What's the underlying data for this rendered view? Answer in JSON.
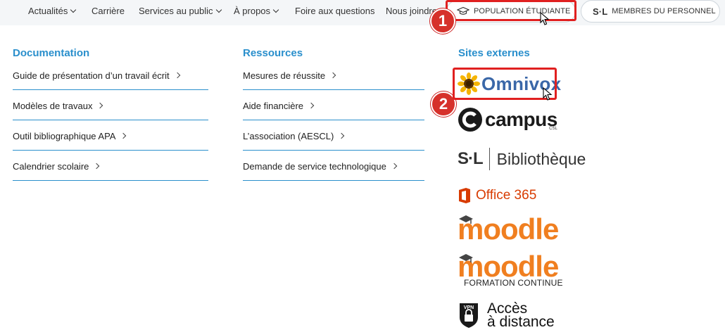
{
  "nav": {
    "items": [
      {
        "label": "Actualités",
        "dropdown": true
      },
      {
        "label": "Carrière",
        "dropdown": false
      },
      {
        "label": "Services au public",
        "dropdown": true
      },
      {
        "label": "À propos",
        "dropdown": true
      },
      {
        "label": "Foire aux questions",
        "dropdown": false
      },
      {
        "label": "Nous joindre",
        "dropdown": false
      }
    ],
    "students_button": "POPULATION ÉTUDIANTE",
    "staff_button": "MEMBRES DU PERSONNEL",
    "staff_logo": "S·L"
  },
  "annotations": {
    "step1": "1",
    "step2": "2",
    "highlight_color": "#e02020"
  },
  "documentation": {
    "title": "Documentation",
    "links": [
      "Guide de présentation d’un travail écrit",
      "Modèles de travaux",
      "Outil bibliographique APA",
      "Calendrier scolaire"
    ]
  },
  "ressources": {
    "title": "Ressources",
    "links": [
      "Mesures de réussite",
      "Aide financière",
      "L’association (AESCL)",
      "Demande de service technologique"
    ]
  },
  "sites": {
    "title": "Sites externes",
    "omnivox": "Omnivox",
    "campus": "campus",
    "campus_sub": "CSL",
    "biblio_mark": "S·L",
    "biblio": "Bibliothèque",
    "office": "Office 365",
    "moodle": "moodle",
    "moodle_fc": "moodle",
    "moodle_fc_sub": "FORMATION CONTINUE",
    "vpn_badge": "VPN",
    "vpn_line1": "Accès",
    "vpn_line2": "à distance"
  },
  "colors": {
    "accent": "#2a8fcc",
    "badge": "#d6312b",
    "moodle": "#f07f20",
    "office": "#d83b01",
    "omnivox": "#3a67a8"
  }
}
